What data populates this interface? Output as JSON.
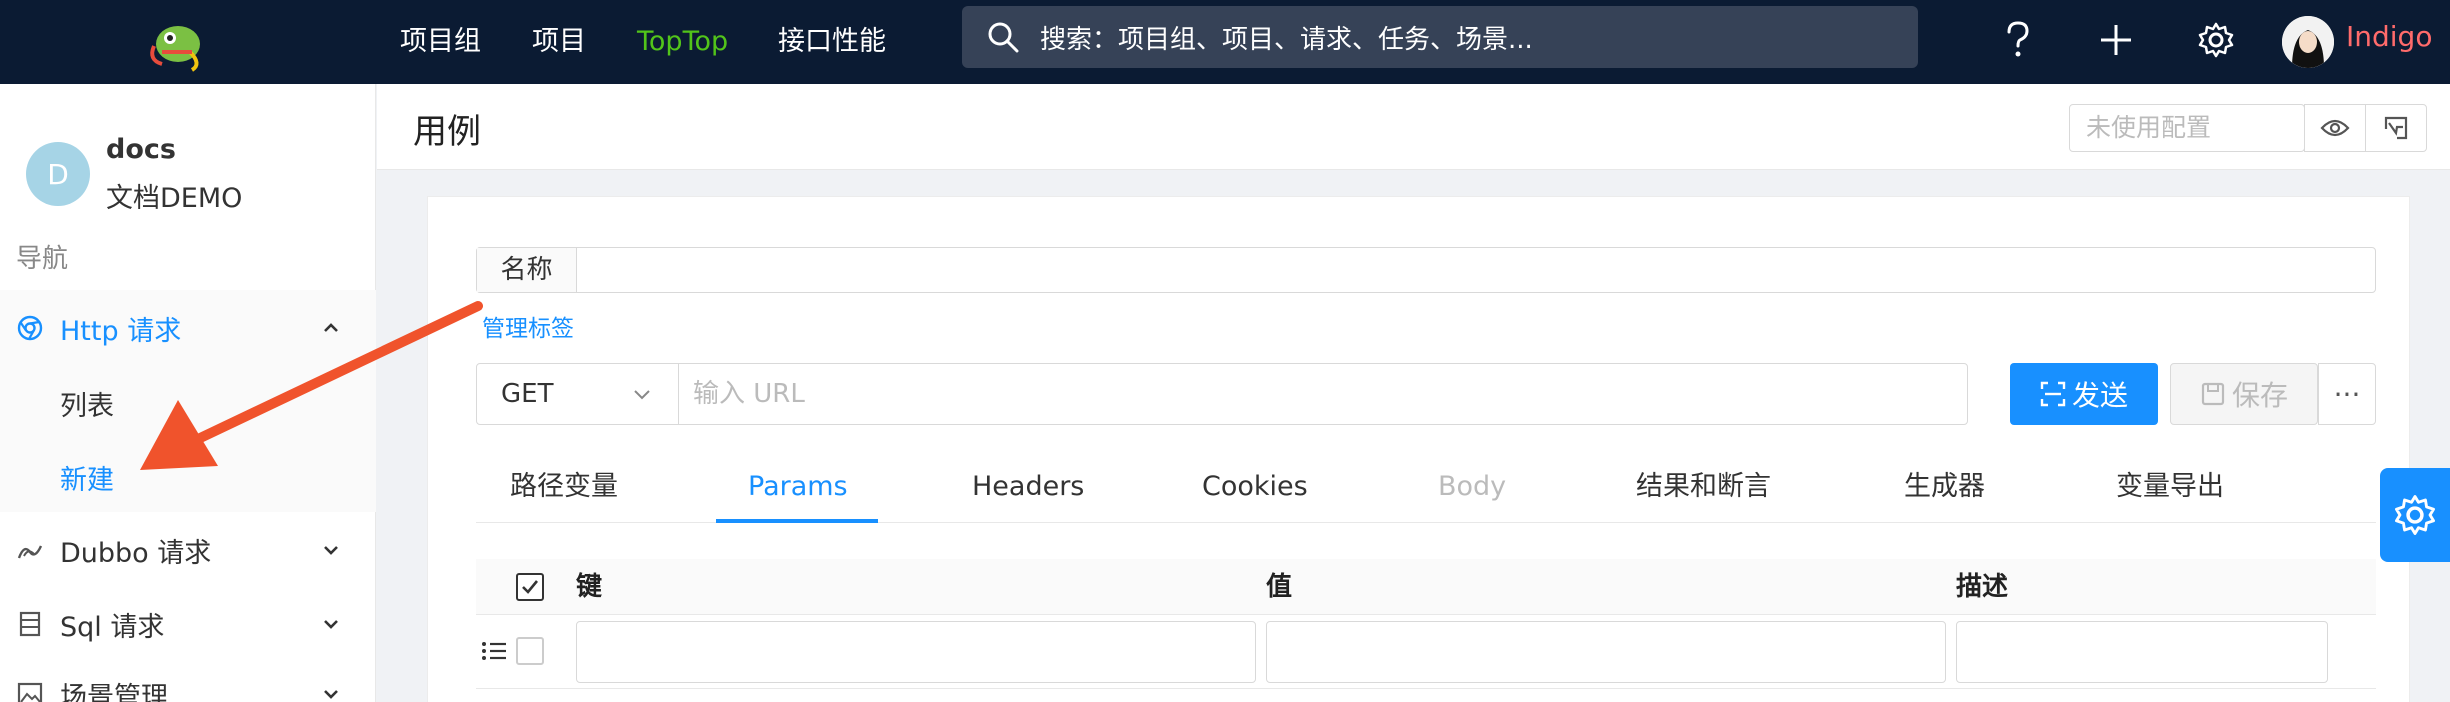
{
  "topbar": {
    "nav": [
      "项目组",
      "项目",
      "TopTop",
      "接口性能"
    ],
    "search_placeholder": "搜索：项目组、项目、请求、任务、场景...",
    "icons": [
      "question-icon",
      "plus-icon",
      "gear-icon"
    ],
    "user_name": "Indigo"
  },
  "sidebar": {
    "project_initial": "D",
    "project_name": "docs",
    "project_subtitle": "文档DEMO",
    "nav_label": "导航",
    "menu": [
      {
        "label": "Http 请求",
        "icon": "chrome-icon",
        "expanded": true
      },
      {
        "label": "Dubbo 请求",
        "icon": "dubbo-icon",
        "expanded": false
      },
      {
        "label": "Sql 请求",
        "icon": "database-icon",
        "expanded": false
      },
      {
        "label": "场景管理",
        "icon": "image-icon",
        "expanded": false
      }
    ],
    "submenu": [
      "列表",
      "新建"
    ],
    "active_sub": "新建"
  },
  "page": {
    "title": "用例",
    "config_placeholder": "未使用配置"
  },
  "form": {
    "name_label": "名称",
    "tag_link": "管理标签",
    "method": "GET",
    "url_placeholder": "输入 URL",
    "send": "发送",
    "save": "保存",
    "more": "···"
  },
  "tabs": {
    "items": [
      "路径变量",
      "Params",
      "Headers",
      "Cookies",
      "Body",
      "结果和断言",
      "生成器",
      "变量导出"
    ],
    "active": "Params",
    "disabled": "Body"
  },
  "table": {
    "headers": [
      "键",
      "值",
      "描述"
    ]
  },
  "colors": {
    "navbar": "#0b1b33",
    "accent": "#1890ff",
    "active_nav": "#52c41a",
    "user_name": "#ff6b6b",
    "annotation_arrow": "#f0532c"
  }
}
